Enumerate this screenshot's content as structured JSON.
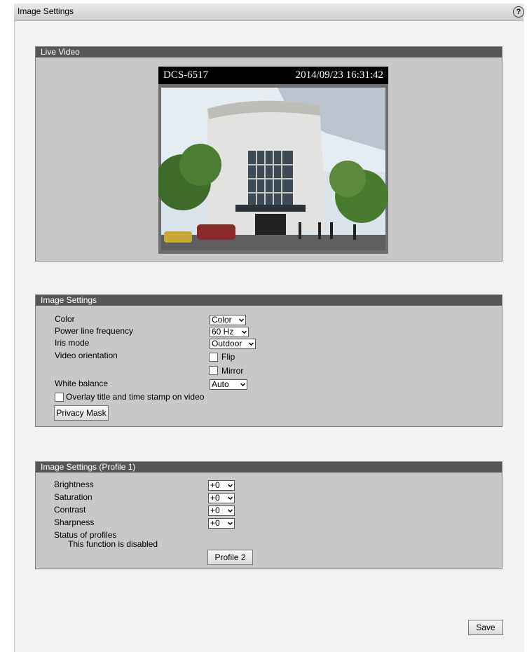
{
  "window": {
    "title": "Image Settings",
    "help_icon": "?"
  },
  "live_video": {
    "header": "Live Video",
    "camera_name": "DCS-6517",
    "timestamp": "2014/09/23 16:31:42"
  },
  "image_settings": {
    "header": "Image Settings",
    "color": {
      "label": "Color",
      "value": "Color"
    },
    "power_line": {
      "label": "Power line frequency",
      "value": "60 Hz"
    },
    "iris": {
      "label": "Iris mode",
      "value": "Outdoor"
    },
    "orientation": {
      "label": "Video orientation",
      "flip": "Flip",
      "mirror": "Mirror"
    },
    "white_balance": {
      "label": "White balance",
      "value": "Auto"
    },
    "overlay": "Overlay title and time stamp on video",
    "privacy_mask": "Privacy Mask"
  },
  "profile": {
    "header": "Image Settings (Profile 1)",
    "brightness": {
      "label": "Brightness",
      "value": "+0"
    },
    "saturation": {
      "label": "Saturation",
      "value": "+0"
    },
    "contrast": {
      "label": "Contrast",
      "value": "+0"
    },
    "sharpness": {
      "label": "Sharpness",
      "value": "+0"
    },
    "status_label": "Status of profiles",
    "status_text": "This function is disabled",
    "profile2": "Profile 2"
  },
  "save": "Save"
}
